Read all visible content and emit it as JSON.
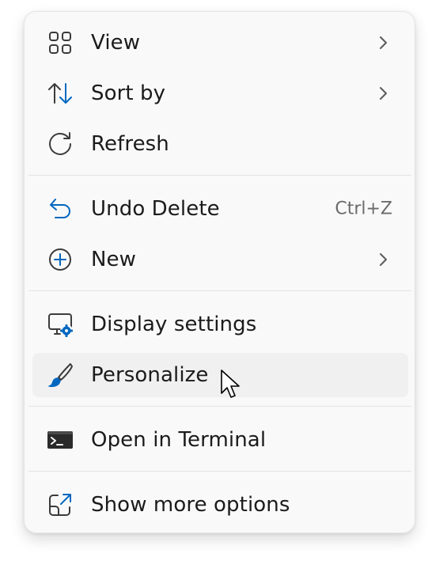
{
  "menu": {
    "items": [
      {
        "label": "View",
        "icon": "grid-icon"
      },
      {
        "label": "Sort by",
        "icon": "sort-arrows-icon"
      },
      {
        "label": "Refresh",
        "icon": "refresh-icon"
      },
      {
        "label": "Undo Delete",
        "icon": "undo-icon",
        "shortcut": "Ctrl+Z"
      },
      {
        "label": "New",
        "icon": "plus-circle-icon"
      },
      {
        "label": "Display settings",
        "icon": "display-settings-icon"
      },
      {
        "label": "Personalize",
        "icon": "paintbrush-icon"
      },
      {
        "label": "Open in Terminal",
        "icon": "terminal-icon"
      },
      {
        "label": "Show more options",
        "icon": "share-external-icon"
      }
    ],
    "highlighted_item": "Personalize"
  },
  "colors": {
    "accent": "#0067c0",
    "icon_stroke": "#3b3b3b",
    "menu_background": "#f9f9f9",
    "highlight": "#f0f0f0",
    "shortcut_text": "#6b6b6b"
  }
}
